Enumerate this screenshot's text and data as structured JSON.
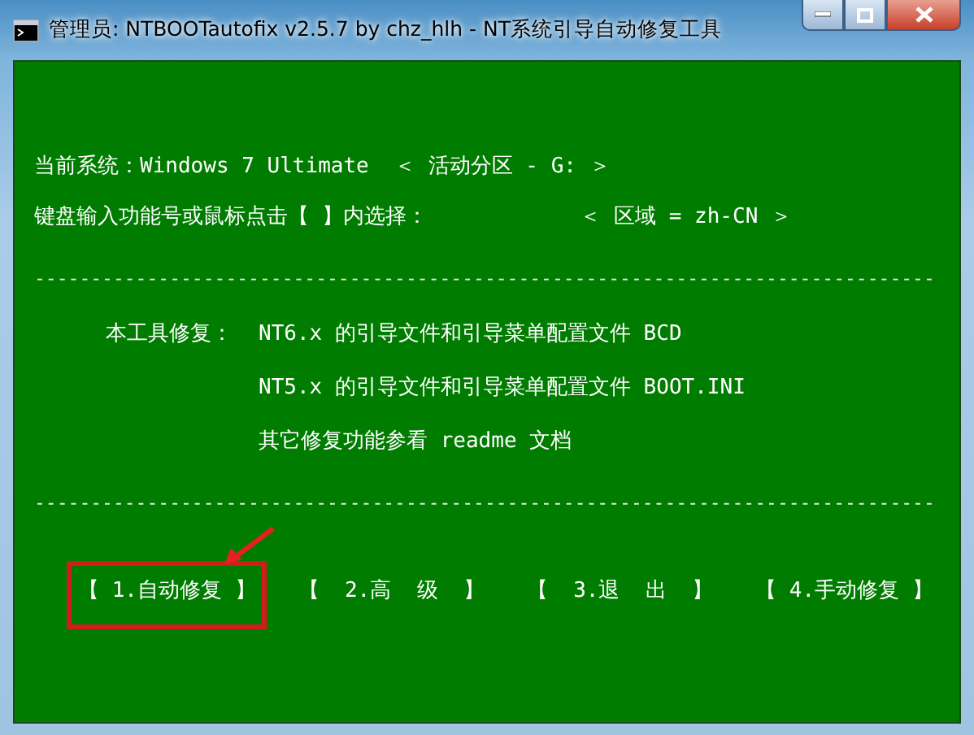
{
  "window": {
    "title": "管理员:  NTBOOTautofix v2.5.7 by chz_hlh - NT系统引导自动修复工具"
  },
  "info": {
    "system": "当前系统：Windows 7 Ultimate  ＜ 活动分区 - G: ＞",
    "prompt": "键盘输入功能号或鼠标点击【 】内选择：",
    "region": "＜ 区域 = zh-CN ＞"
  },
  "dividers": [
    "--------------------------------------------------------------------------------",
    "--------------------------------------------------------------------------------"
  ],
  "repair": {
    "label": "本工具修复：",
    "lines": [
      "NT6.x 的引导文件和引导菜单配置文件 BCD",
      "NT5.x 的引导文件和引导菜单配置文件 BOOT.INI",
      "其它修复功能参看 readme 文档"
    ]
  },
  "options": [
    {
      "label": "【 1.自动修复 】",
      "highlighted": true
    },
    {
      "label": "【  2.高  级  】",
      "highlighted": false
    },
    {
      "label": "【  3.退  出  】",
      "highlighted": false
    },
    {
      "label": "【 4.手动修复 】",
      "highlighted": false
    }
  ]
}
